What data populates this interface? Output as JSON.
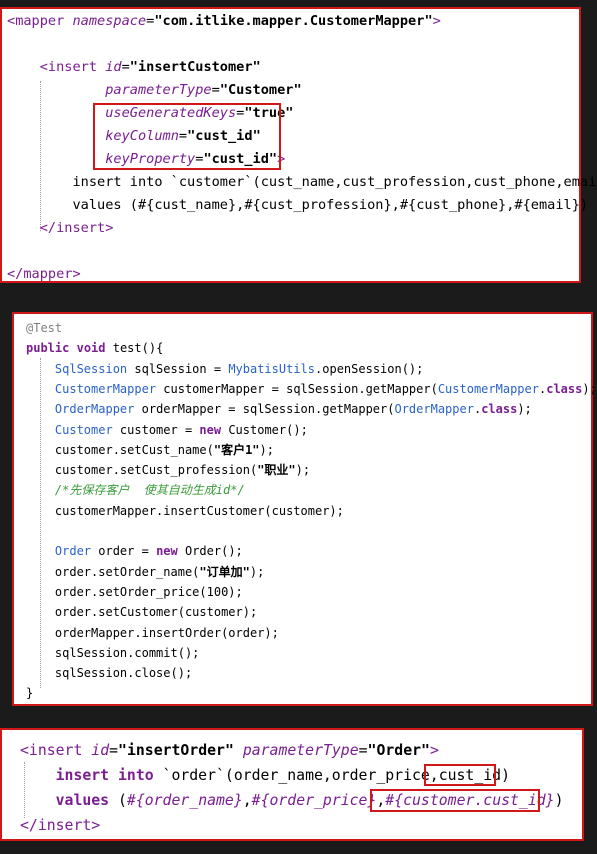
{
  "panel1": {
    "lines": [
      [
        {
          "t": "<",
          "c": "tag"
        },
        {
          "t": "mapper",
          "c": "tag"
        },
        {
          "t": " ",
          "c": ""
        },
        {
          "t": "namespace",
          "c": "attr"
        },
        {
          "t": "=",
          "c": "eq"
        },
        {
          "t": "\"",
          "c": "strq"
        },
        {
          "t": "com.itlike.mapper.CustomerMapper",
          "c": "str"
        },
        {
          "t": "\"",
          "c": "strq"
        },
        {
          "t": ">",
          "c": "tag"
        }
      ],
      [],
      [
        {
          "t": "    <",
          "c": "tag"
        },
        {
          "t": "insert",
          "c": "tag"
        },
        {
          "t": " ",
          "c": ""
        },
        {
          "t": "id",
          "c": "attr"
        },
        {
          "t": "=",
          "c": "eq"
        },
        {
          "t": "\"",
          "c": "strq"
        },
        {
          "t": "insertCustomer",
          "c": "str"
        },
        {
          "t": "\"",
          "c": "strq"
        }
      ],
      [
        {
          "t": "            ",
          "c": ""
        },
        {
          "t": "parameterType",
          "c": "attr"
        },
        {
          "t": "=",
          "c": "eq"
        },
        {
          "t": "\"",
          "c": "strq"
        },
        {
          "t": "Customer",
          "c": "str"
        },
        {
          "t": "\"",
          "c": "strq"
        }
      ],
      [
        {
          "t": "            ",
          "c": ""
        },
        {
          "t": "useGeneratedKeys",
          "c": "attr"
        },
        {
          "t": "=",
          "c": "eq"
        },
        {
          "t": "\"",
          "c": "strq"
        },
        {
          "t": "true",
          "c": "str"
        },
        {
          "t": "\"",
          "c": "strq"
        }
      ],
      [
        {
          "t": "            ",
          "c": ""
        },
        {
          "t": "keyColumn",
          "c": "attr"
        },
        {
          "t": "=",
          "c": "eq"
        },
        {
          "t": "\"",
          "c": "strq"
        },
        {
          "t": "cust_id",
          "c": "str"
        },
        {
          "t": "\"",
          "c": "strq"
        }
      ],
      [
        {
          "t": "            ",
          "c": ""
        },
        {
          "t": "keyProperty",
          "c": "attr"
        },
        {
          "t": "=",
          "c": "eq"
        },
        {
          "t": "\"",
          "c": "strq"
        },
        {
          "t": "cust_id",
          "c": "str"
        },
        {
          "t": "\"",
          "c": "strq"
        },
        {
          "t": ">",
          "c": "tag"
        }
      ],
      [
        {
          "t": "        insert into `customer`(cust_name,cust_profession,cust_phone,email)",
          "c": ""
        }
      ],
      [
        {
          "t": "        values (#{cust_name},#{cust_profession},#{cust_phone},#{email})",
          "c": ""
        }
      ],
      [
        {
          "t": "    </",
          "c": "tag"
        },
        {
          "t": "insert",
          "c": "tag"
        },
        {
          "t": ">",
          "c": "tag"
        }
      ],
      [],
      [
        {
          "t": "</",
          "c": "tag"
        },
        {
          "t": "mapper",
          "c": "tag"
        },
        {
          "t": ">",
          "c": "tag"
        }
      ]
    ]
  },
  "panel2": {
    "lines": [
      [
        {
          "t": "@Test",
          "c": "ann"
        }
      ],
      [
        {
          "t": "public",
          "c": "jkw"
        },
        {
          "t": " ",
          "c": ""
        },
        {
          "t": "void",
          "c": "jkw"
        },
        {
          "t": " test(){",
          "c": ""
        }
      ],
      [
        {
          "t": "    ",
          "c": ""
        },
        {
          "t": "SqlSession",
          "c": "cls"
        },
        {
          "t": " sqlSession = ",
          "c": ""
        },
        {
          "t": "MybatisUtils",
          "c": "cls"
        },
        {
          "t": ".openSession();",
          "c": ""
        }
      ],
      [
        {
          "t": "    ",
          "c": ""
        },
        {
          "t": "CustomerMapper",
          "c": "cls"
        },
        {
          "t": " customerMapper = sqlSession.getMapper(",
          "c": ""
        },
        {
          "t": "CustomerMapper",
          "c": "cls"
        },
        {
          "t": ".",
          "c": ""
        },
        {
          "t": "class",
          "c": "jkw"
        },
        {
          "t": ");",
          "c": ""
        }
      ],
      [
        {
          "t": "    ",
          "c": ""
        },
        {
          "t": "OrderMapper",
          "c": "cls"
        },
        {
          "t": " orderMapper = sqlSession.getMapper(",
          "c": ""
        },
        {
          "t": "OrderMapper",
          "c": "cls"
        },
        {
          "t": ".",
          "c": ""
        },
        {
          "t": "class",
          "c": "jkw"
        },
        {
          "t": ");",
          "c": ""
        }
      ],
      [
        {
          "t": "    ",
          "c": ""
        },
        {
          "t": "Customer",
          "c": "cls"
        },
        {
          "t": " customer = ",
          "c": ""
        },
        {
          "t": "new",
          "c": "jkw"
        },
        {
          "t": " Customer();",
          "c": ""
        }
      ],
      [
        {
          "t": "    customer.setCust_name(",
          "c": ""
        },
        {
          "t": "\"客户1\"",
          "c": "jstr"
        },
        {
          "t": ");",
          "c": ""
        }
      ],
      [
        {
          "t": "    customer.setCust_profession(",
          "c": ""
        },
        {
          "t": "\"职业\"",
          "c": "jstr"
        },
        {
          "t": ");",
          "c": ""
        }
      ],
      [
        {
          "t": "    ",
          "c": ""
        },
        {
          "t": "/*先保存客户  使其自动生成id*/",
          "c": "cmt"
        }
      ],
      [
        {
          "t": "    customerMapper.insertCustomer(customer);",
          "c": ""
        }
      ],
      [],
      [
        {
          "t": "    ",
          "c": ""
        },
        {
          "t": "Order",
          "c": "cls"
        },
        {
          "t": " order = ",
          "c": ""
        },
        {
          "t": "new",
          "c": "jkw"
        },
        {
          "t": " Order();",
          "c": ""
        }
      ],
      [
        {
          "t": "    order.setOrder_name(",
          "c": ""
        },
        {
          "t": "\"订单加\"",
          "c": "jstr"
        },
        {
          "t": ");",
          "c": ""
        }
      ],
      [
        {
          "t": "    order.setOrder_price(100);",
          "c": ""
        }
      ],
      [
        {
          "t": "    order.setCustomer(customer);",
          "c": ""
        }
      ],
      [
        {
          "t": "    orderMapper.insertOrder(order);",
          "c": ""
        }
      ],
      [
        {
          "t": "    sqlSession.commit();",
          "c": ""
        }
      ],
      [
        {
          "t": "    sqlSession.close();",
          "c": ""
        }
      ],
      [
        {
          "t": "}",
          "c": ""
        }
      ]
    ]
  },
  "panel3": {
    "lines": [
      [
        {
          "t": "<",
          "c": "tag"
        },
        {
          "t": "insert",
          "c": "tag"
        },
        {
          "t": " ",
          "c": ""
        },
        {
          "t": "id",
          "c": "attr"
        },
        {
          "t": "=",
          "c": "eq"
        },
        {
          "t": "\"",
          "c": "strq"
        },
        {
          "t": "insertOrder",
          "c": "str"
        },
        {
          "t": "\"",
          "c": "strq"
        },
        {
          "t": " ",
          "c": ""
        },
        {
          "t": "parameterType",
          "c": "attr"
        },
        {
          "t": "=",
          "c": "eq"
        },
        {
          "t": "\"",
          "c": "strq"
        },
        {
          "t": "Order",
          "c": "str"
        },
        {
          "t": "\"",
          "c": "strq"
        },
        {
          "t": ">",
          "c": "tag"
        }
      ],
      [
        {
          "t": "    ",
          "c": ""
        },
        {
          "t": "insert into",
          "c": "kw"
        },
        {
          "t": " `order`(order_name,order_price,cust_id)",
          "c": ""
        }
      ],
      [
        {
          "t": "    ",
          "c": ""
        },
        {
          "t": "values",
          "c": "kw"
        },
        {
          "t": " (",
          "c": ""
        },
        {
          "t": "#{order_name}",
          "c": "attr"
        },
        {
          "t": ",",
          "c": ""
        },
        {
          "t": "#{order_price}",
          "c": "attr"
        },
        {
          "t": ",",
          "c": ""
        },
        {
          "t": "#{customer.cust_id}",
          "c": "attr"
        },
        {
          "t": ")",
          "c": ""
        }
      ],
      [
        {
          "t": "</",
          "c": "tag"
        },
        {
          "t": "insert",
          "c": "tag"
        },
        {
          "t": ">",
          "c": "tag"
        }
      ]
    ]
  }
}
